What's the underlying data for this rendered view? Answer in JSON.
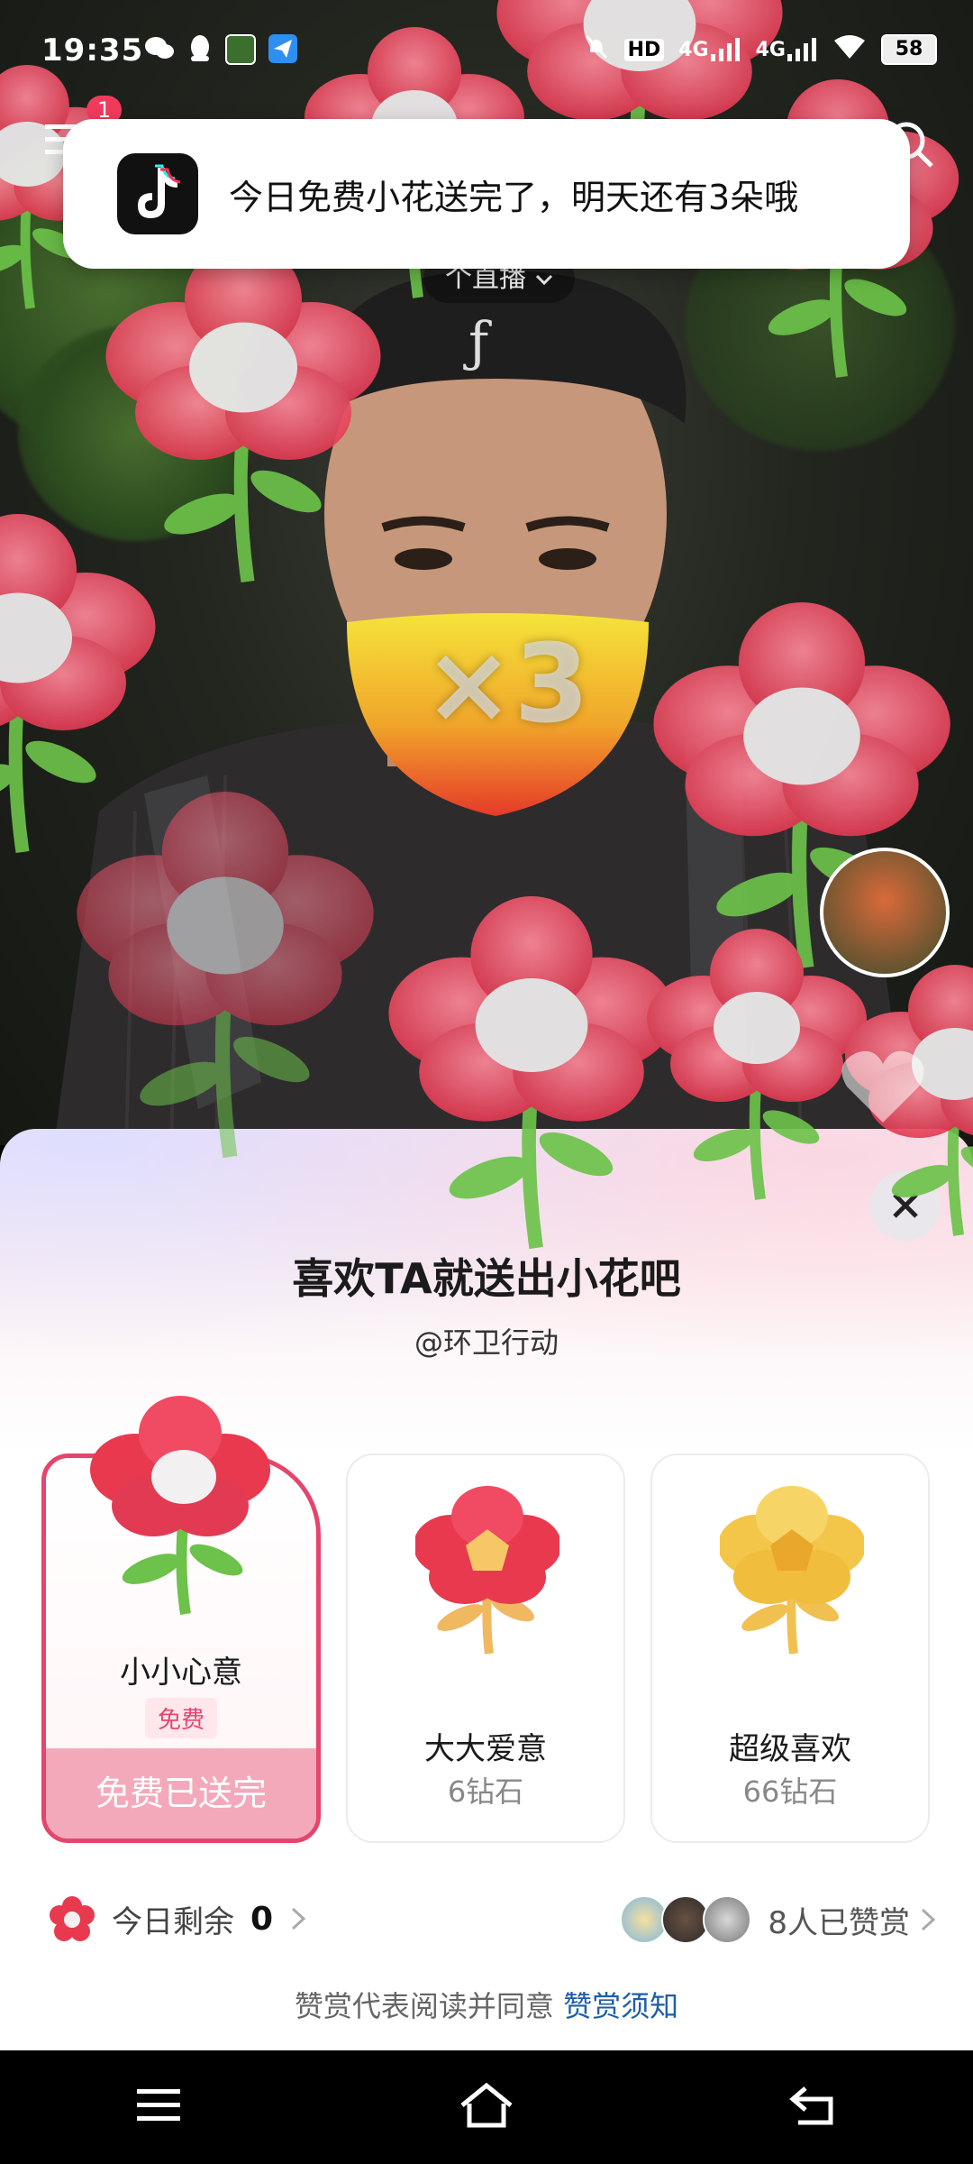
{
  "status_bar": {
    "time": "19:35",
    "network_labels": [
      "HD",
      "4G",
      "4G"
    ],
    "battery": "58"
  },
  "toast": {
    "message": "今日免费小花送完了，明天还有3朵哦"
  },
  "video": {
    "live_pill": "个直播",
    "multiplier": "×3",
    "notification_badge": "1"
  },
  "gift_panel": {
    "title": "喜欢TA就送出小花吧",
    "subtitle": "@环卫行动",
    "close_icon": "close-icon",
    "cards": [
      {
        "name": "小小心意",
        "tag": "免费",
        "button": "免费已送完",
        "selected": true,
        "color": "#e5456c"
      },
      {
        "name": "大大爱意",
        "price": "6钻石",
        "selected": false,
        "color": "#e84a5f"
      },
      {
        "name": "超级喜欢",
        "price": "66钻石",
        "selected": false,
        "color": "#f2c94c"
      }
    ],
    "remain_label": "今日剩余",
    "remain_count": "0",
    "supporters_label": "8人已赞赏",
    "agreement_prefix": "赞赏代表阅读并同意",
    "agreement_link": "赞赏须知"
  },
  "colors": {
    "accent": "#e5456c",
    "link": "#1e5ea8"
  }
}
